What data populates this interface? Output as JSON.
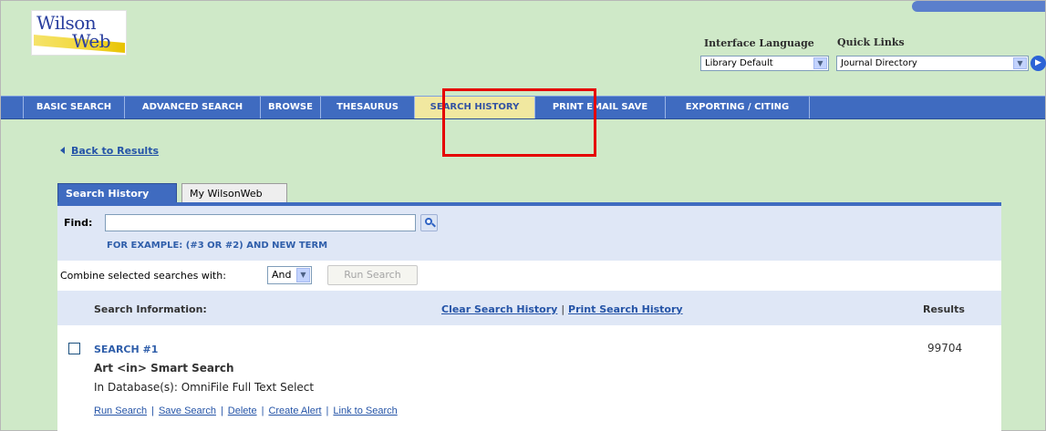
{
  "header": {
    "logo_top": "Wilson",
    "logo_bottom": "Web",
    "interface_language_label": "Interface Language",
    "interface_language_value": "Library Default",
    "quick_links_label": "Quick Links",
    "quick_links_value": "Journal Directory"
  },
  "nav": {
    "items": [
      {
        "label": "BASIC SEARCH"
      },
      {
        "label": "ADVANCED SEARCH"
      },
      {
        "label": "BROWSE"
      },
      {
        "label": "THESAURUS"
      },
      {
        "label": "SEARCH HISTORY",
        "active": true
      },
      {
        "label": "PRINT EMAIL SAVE"
      },
      {
        "label": "EXPORTING / CITING"
      }
    ]
  },
  "back_link": "Back to Results",
  "tabs": [
    {
      "label": "Search History",
      "active": true
    },
    {
      "label": "My WilsonWeb"
    }
  ],
  "find": {
    "label": "Find:",
    "value": "",
    "example": "FOR EXAMPLE: (#3 OR #2) AND NEW TERM"
  },
  "combine": {
    "label": "Combine selected searches with:",
    "operator": "And",
    "run_button": "Run Search"
  },
  "table_header": {
    "info": "Search Information:",
    "clear": "Clear Search History",
    "separator": "|",
    "print": "Print Search History",
    "results": "Results"
  },
  "searches": [
    {
      "title": "SEARCH #1",
      "query": "Art <in> Smart Search",
      "databases": "In Database(s): OmniFile Full Text Select",
      "results": "99704",
      "actions": [
        "Run Search",
        "Save Search",
        "Delete",
        "Create Alert",
        "Link to Search"
      ]
    }
  ],
  "colors": {
    "page_background": "#cfe9c8",
    "nav_background": "#3f6bc0",
    "active_tab": "#f1e8a0",
    "highlight": "#e50000",
    "link": "#2554a7"
  }
}
